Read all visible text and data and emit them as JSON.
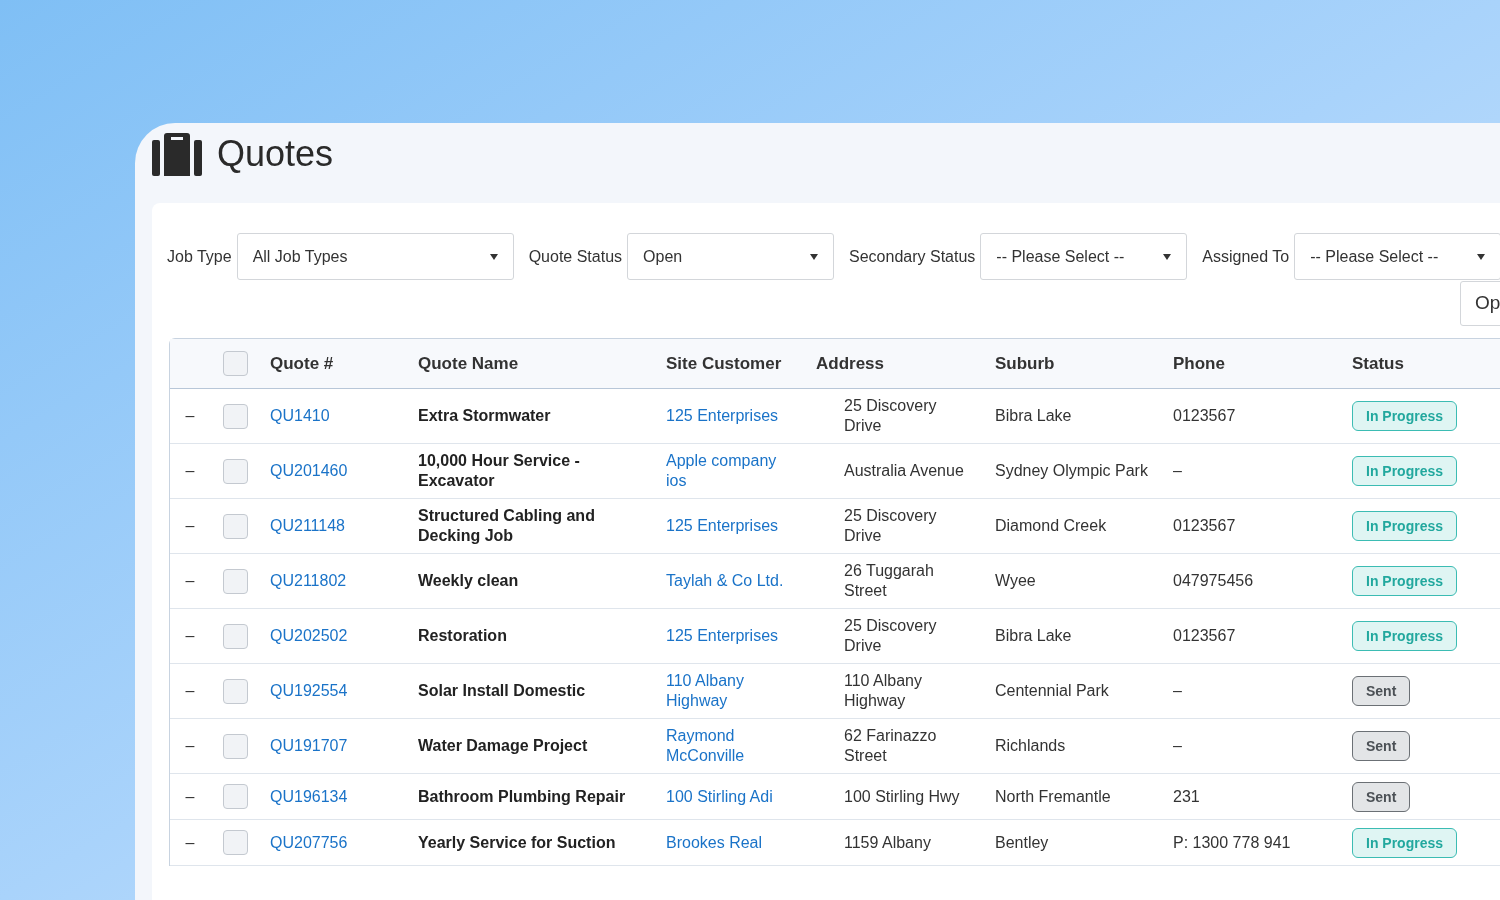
{
  "page": {
    "title": "Quotes"
  },
  "filters": [
    {
      "label": "Job Type",
      "value": "All Job Types"
    },
    {
      "label": "Quote Status",
      "value": "Open"
    },
    {
      "label": "Secondary Status",
      "value": "-- Please Select --"
    },
    {
      "label": "Assigned To",
      "value": "-- Please Select --"
    }
  ],
  "filter_button": {
    "label": "Op"
  },
  "table": {
    "select_all": {
      "checked": false
    },
    "columns": [
      "Quote #",
      "Quote Name",
      "Site Customer",
      "Address",
      "Suburb",
      "Phone",
      "Status"
    ],
    "rows": [
      {
        "expand": "–",
        "checked": false,
        "quote": "QU1410",
        "name": "Extra Stormwater",
        "customer": "125 Enterprises",
        "address": "25 Discovery Drive",
        "suburb": "Bibra Lake",
        "phone": "0123567",
        "status": {
          "label": "In Progress",
          "kind": "progress"
        }
      },
      {
        "expand": "–",
        "checked": false,
        "quote": "QU201460",
        "name": "10,000 Hour Service - Excavator",
        "customer": "Apple company ios",
        "address": "Australia Avenue",
        "suburb": "Sydney Olympic Park",
        "phone": "–",
        "status": {
          "label": "In Progress",
          "kind": "progress"
        }
      },
      {
        "expand": "–",
        "checked": false,
        "quote": "QU211148",
        "name": "Structured Cabling and Decking Job",
        "customer": "125 Enterprises",
        "address": "25 Discovery Drive",
        "suburb": "Diamond Creek",
        "phone": "0123567",
        "status": {
          "label": "In Progress",
          "kind": "progress"
        }
      },
      {
        "expand": "–",
        "checked": false,
        "quote": "QU211802",
        "name": "Weekly clean",
        "customer": "Taylah & Co Ltd.",
        "address": "26 Tuggarah Street",
        "suburb": "Wyee",
        "phone": "047975456",
        "status": {
          "label": "In Progress",
          "kind": "progress"
        }
      },
      {
        "expand": "–",
        "checked": false,
        "quote": "QU202502",
        "name": "Restoration",
        "customer": "125 Enterprises",
        "address": "25 Discovery Drive",
        "suburb": "Bibra Lake",
        "phone": "0123567",
        "status": {
          "label": "In Progress",
          "kind": "progress"
        }
      },
      {
        "expand": "–",
        "checked": false,
        "quote": "QU192554",
        "name": "Solar Install Domestic",
        "customer": "110 Albany Highway",
        "address": "110 Albany Highway",
        "suburb": "Centennial Park",
        "phone": "–",
        "status": {
          "label": "Sent",
          "kind": "sent"
        }
      },
      {
        "expand": "–",
        "checked": false,
        "quote": "QU191707",
        "name": "Water Damage Project",
        "customer": "Raymond McConville",
        "address": "62 Farinazzo Street",
        "suburb": "Richlands",
        "phone": "–",
        "status": {
          "label": "Sent",
          "kind": "sent"
        }
      },
      {
        "expand": "–",
        "checked": false,
        "quote": "QU196134",
        "name": "Bathroom Plumbing Repair",
        "customer": "100 Stirling Adi",
        "address": "100 Stirling Hwy",
        "suburb": "North Fremantle",
        "phone": "231",
        "status": {
          "label": "Sent",
          "kind": "sent"
        }
      },
      {
        "expand": "–",
        "checked": false,
        "quote": "QU207756",
        "name": "Yearly Service for Suction",
        "customer": "Brookes Real",
        "address": "1159 Albany",
        "suburb": "Bentley",
        "phone": "P: 1300 778 941",
        "status": {
          "label": "In Progress",
          "kind": "progress"
        }
      }
    ]
  }
}
